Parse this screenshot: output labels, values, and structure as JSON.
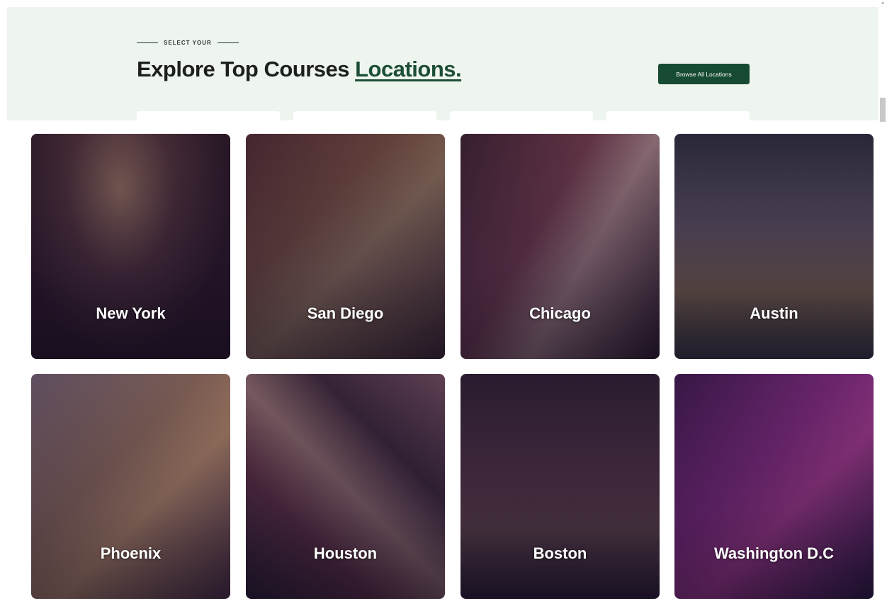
{
  "hero": {
    "eyebrow": "SELECT YOUR",
    "title_main": "Explore Top Courses ",
    "title_accent": "Locations.",
    "browse_button": "Browse All Locations"
  },
  "locations": [
    {
      "name": "New York"
    },
    {
      "name": "San Diego"
    },
    {
      "name": "Chicago"
    },
    {
      "name": "Austin"
    },
    {
      "name": "Phoenix"
    },
    {
      "name": "Houston"
    },
    {
      "name": "Boston"
    },
    {
      "name": "Washington D.C"
    }
  ]
}
